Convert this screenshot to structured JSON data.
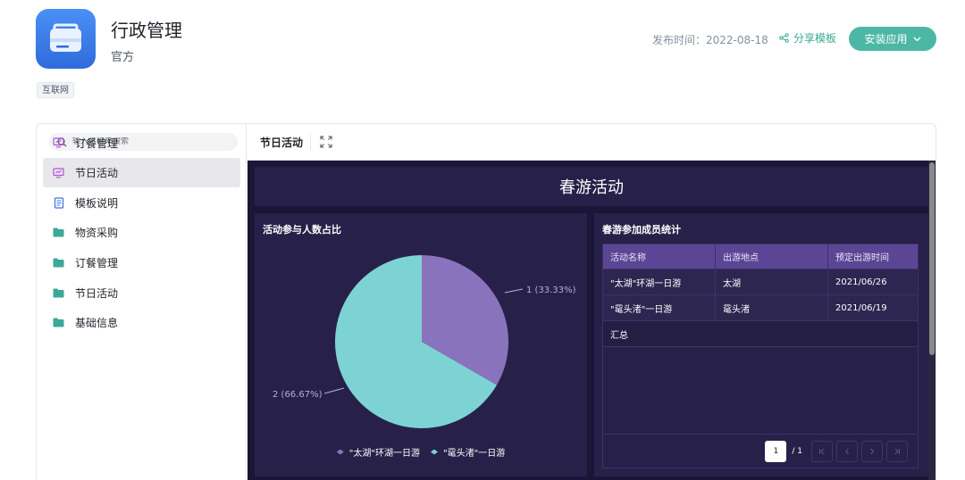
{
  "header": {
    "title": "行政管理",
    "subtitle": "官方",
    "tag": "互联网",
    "publish_label": "发布时间：2022-08-18",
    "share_label": "分享模板",
    "install_label": "安装应用"
  },
  "sidebar": {
    "search_placeholder": "输入名称来搜索",
    "items": [
      {
        "label": "物资采购",
        "icon": "screen-icon"
      },
      {
        "label": "订餐管理",
        "icon": "screen-icon"
      },
      {
        "label": "节日活动",
        "icon": "screen-icon"
      },
      {
        "label": "模板说明",
        "icon": "document-icon"
      },
      {
        "label": "物资采购",
        "icon": "folder-icon"
      },
      {
        "label": "订餐管理",
        "icon": "folder-icon"
      },
      {
        "label": "节日活动",
        "icon": "folder-icon"
      },
      {
        "label": "基础信息",
        "icon": "folder-icon"
      }
    ],
    "active_index": 2
  },
  "main": {
    "tab_label": "节日活动",
    "dashboard_title": "春游活动",
    "pie_card": {
      "title": "活动参与人数占比",
      "label_a": "1 (33.33%)",
      "label_b": "2 (66.67%)"
    },
    "table_card": {
      "title": "春游参加成员统计",
      "headers": [
        "活动名称",
        "出游地点",
        "预定出游时间"
      ],
      "rows": [
        [
          "\"太湖\"环湖一日游",
          "太湖",
          "2021/06/26"
        ],
        [
          "\"鼋头渚\"一日游",
          "鼋头渚",
          "2021/06/19"
        ]
      ],
      "summary_label": "汇总",
      "pager": {
        "current": "1",
        "total": "/ 1"
      }
    }
  },
  "colors": {
    "accent": "#4cb7a5",
    "pie_purple": "#8a73bd",
    "pie_teal": "#7dd3d3",
    "dashboard_bg": "#1b1637",
    "card_bg": "#272149",
    "table_header": "#5b4696"
  },
  "chart_data": {
    "type": "pie",
    "title": "活动参与人数占比",
    "series": [
      {
        "name": "\"太湖\"环湖一日游",
        "value": 1,
        "percent": 33.33,
        "color": "#8a73bd"
      },
      {
        "name": "\"鼋头渚\"一日游",
        "value": 2,
        "percent": 66.67,
        "color": "#7dd3d3"
      }
    ],
    "legend": "bottom"
  }
}
